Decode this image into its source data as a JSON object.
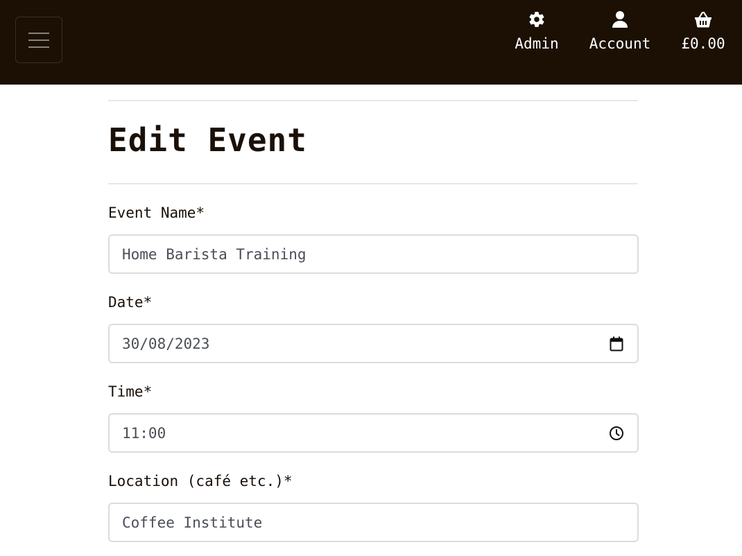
{
  "navbar": {
    "menu_icon": "hamburger-menu-icon",
    "links": {
      "admin": {
        "label": "Admin",
        "icon": "gear-icon"
      },
      "account": {
        "label": "Account",
        "icon": "user-icon"
      },
      "basket": {
        "label": "£0.00",
        "icon": "basket-icon"
      }
    },
    "colors": {
      "background": "#1c1005",
      "text": "#ffffff"
    }
  },
  "page": {
    "title": "Edit Event"
  },
  "form": {
    "event_name": {
      "label": "Event Name*",
      "value": "Home Barista Training"
    },
    "date": {
      "label": "Date*",
      "value": "30/08/2023",
      "icon": "calendar-icon"
    },
    "time": {
      "label": "Time*",
      "value": "11:00",
      "icon": "clock-icon"
    },
    "location": {
      "label": "Location (café etc.)*",
      "value": "Coffee Institute"
    }
  }
}
